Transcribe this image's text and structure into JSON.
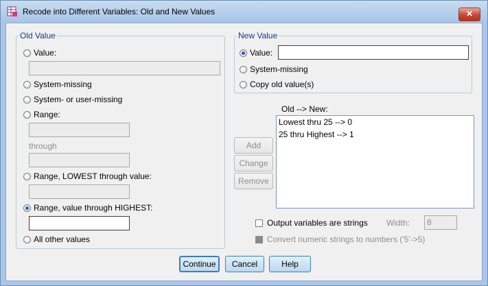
{
  "window": {
    "title": "Recode into Different Variables: Old and New Values",
    "close_symbol": "✕"
  },
  "old_value": {
    "legend": "Old Value",
    "value_label": "Value:",
    "system_missing_label": "System-missing",
    "system_or_user_missing_label": "System- or user-missing",
    "range_label": "Range:",
    "through_label": "through",
    "range_lowest_label": "Range, LOWEST through value:",
    "range_highest_label": "Range, value through HIGHEST:",
    "range_highest_value": "",
    "all_other_label": "All other values",
    "selected_option": "range_highest"
  },
  "new_value": {
    "legend": "New Value",
    "value_label": "Value:",
    "value_input": "",
    "system_missing_label": "System-missing",
    "copy_old_label": "Copy old value(s)",
    "selected_option": "value"
  },
  "mapping": {
    "label": "Old --> New:",
    "items": [
      "Lowest thru 25 --> 0",
      "25 thru Highest --> 1"
    ]
  },
  "actions": {
    "add": "Add",
    "change": "Change",
    "remove": "Remove"
  },
  "output_options": {
    "strings_label": "Output variables are strings",
    "strings_checked": false,
    "width_label": "Width:",
    "width_value": "8",
    "convert_label": "Convert numeric strings to numbers ('5'->5)",
    "convert_checked": false
  },
  "footer": {
    "continue": "Continue",
    "cancel": "Cancel",
    "help": "Help"
  },
  "colors": {
    "legend_text": "#0b3b8c",
    "frame": "#a9c6e8",
    "radio_selected": "#1b5ec8"
  },
  "icons": {
    "app": "recode-table-icon",
    "close": "close-icon"
  }
}
